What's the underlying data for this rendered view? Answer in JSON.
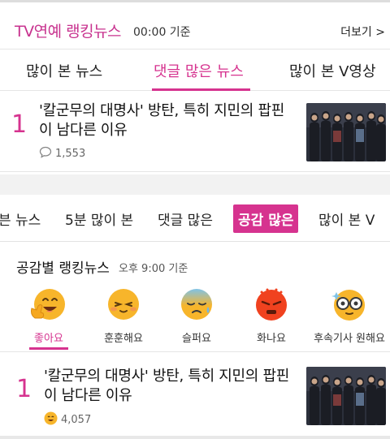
{
  "header": {
    "title": "TV연예 랭킹뉴스",
    "time": "00:00 기준",
    "more_label": "더보기 >"
  },
  "tabs_top": [
    "많이 본 뉴스",
    "댓글 많은 뉴스",
    "많이 본 V영상"
  ],
  "tabs_top_active": 1,
  "article_top": {
    "rank": "1",
    "title_line1": "'칼군무의 대명사' 방탄, 특히 지민의 팝핀",
    "title_line2": "이 남다른 이유",
    "comment_count": "1,553"
  },
  "tabs_bottom": [
    "븐 뉴스",
    "5분 많이 본",
    "댓글 많은",
    "공감 많은",
    "많이 본 V"
  ],
  "tabs_bottom_active": 3,
  "empathy": {
    "title": "공감별 랭킹뉴스",
    "time": "오후 9:00 기준",
    "items": [
      "좋아요",
      "훈훈해요",
      "슬퍼요",
      "화나요",
      "후속기사 원해요"
    ],
    "active_index": 0
  },
  "article_bottom": {
    "rank": "1",
    "title_line1": "'칼군무의 대명사' 방탄, 특히 지민의 팝핀",
    "title_line2": "이 남다른 이유",
    "like_count": "4,057"
  },
  "colors": {
    "accent": "#d6338f",
    "emoji_yellow": "#f7b52b",
    "emoji_red": "#f0421f"
  },
  "icons": [
    "comment-icon",
    "like-emoji-icon",
    "warm-emoji-icon",
    "sad-emoji-icon",
    "angry-emoji-icon",
    "follow-up-emoji-icon"
  ]
}
